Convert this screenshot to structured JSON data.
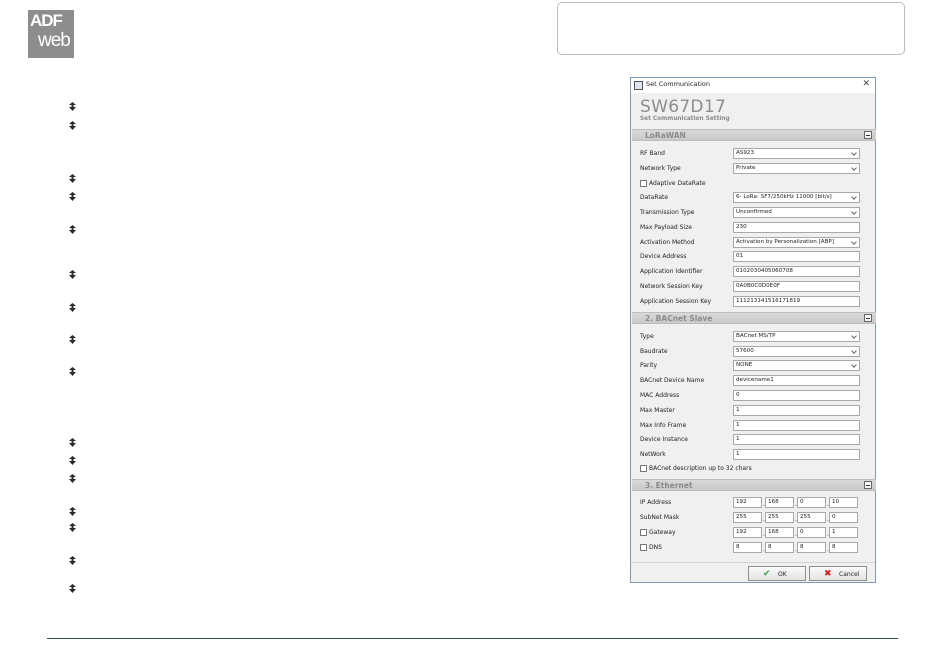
{
  "logo": {
    "line1": "ADF",
    "line2": "web"
  },
  "dialog": {
    "window_title": "Set Communication",
    "close_glyph": "✕",
    "app_name": "SW67D17",
    "app_subtitle": "Set Communication Setting",
    "sections": {
      "lorawan": "LoRaWAN",
      "bacnet": "2. BACnet Slave",
      "ethernet": "3. Ethernet"
    },
    "lorawan": {
      "rf_band_label": "RF Band",
      "rf_band": "AS923",
      "network_type_label": "Network Type",
      "network_type": "Private",
      "adaptive_datarate_label": "Adaptive DataRate",
      "adaptive_datarate_checked": false,
      "datarate_label": "DataRate",
      "datarate": "6- LoRa: SF7/250kHz 11000 [bit/s]",
      "transmission_type_label": "Transmission Type",
      "transmission_type": "Unconfirmed",
      "max_payload_label": "Max Payload Size",
      "max_payload": "230",
      "activation_method_label": "Activation Method",
      "activation_method": "Activation by Personalization [ABP]",
      "device_address_label": "Device Address",
      "device_address": "01",
      "app_identifier_label": "Application Identifier",
      "app_identifier": "0102030405060708",
      "network_session_key_label": "Network Session Key",
      "network_session_key": "0A0B0C0D0E0F",
      "app_session_key_label": "Application Session Key",
      "app_session_key": "111213141516171819"
    },
    "bacnet": {
      "type_label": "Type",
      "type": "BACnet MS/TP",
      "baudrate_label": "Baudrate",
      "baudrate": "57600",
      "parity_label": "Parity",
      "parity": "NONE",
      "device_name_label": "BACnet Device Name",
      "device_name": "devicename1",
      "mac_label": "MAC Address",
      "mac": "0",
      "max_master_label": "Max Master",
      "max_master": "1",
      "max_info_label": "Max Info Frame",
      "max_info": "1",
      "device_instance_label": "Device Instance",
      "device_instance": "1",
      "network_label": "NetWork",
      "network": "1",
      "desc32_label": "BACnet description up to 32 chars",
      "desc32_checked": false
    },
    "ethernet": {
      "ip_label": "IP Address",
      "ip": [
        "192",
        "168",
        "0",
        "10"
      ],
      "subnet_label": "SubNet Mask",
      "subnet": [
        "255",
        "255",
        "255",
        "0"
      ],
      "gateway_label": "Gateway",
      "gateway_checked": false,
      "gateway": [
        "192",
        "168",
        "0",
        "1"
      ],
      "dns_label": "DNS",
      "dns_checked": false,
      "dns": [
        "8",
        "8",
        "8",
        "8"
      ]
    },
    "buttons": {
      "ok": "OK",
      "cancel": "Cancel"
    }
  },
  "colors": {
    "ok_icon": "#3aa83a",
    "cancel_icon": "#d02020",
    "footer_line": "#2f4f4f"
  }
}
